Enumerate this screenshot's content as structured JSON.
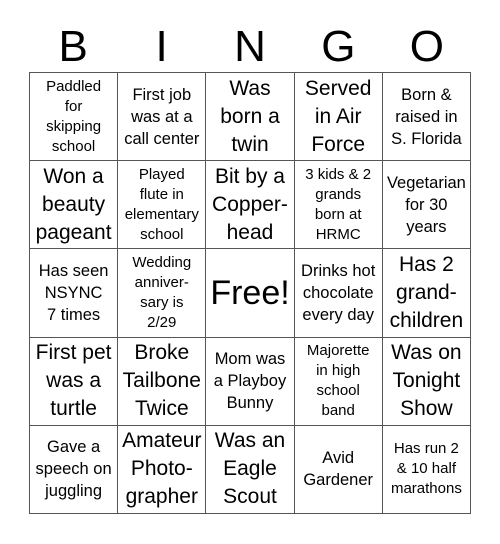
{
  "header": {
    "letters": [
      "B",
      "I",
      "N",
      "G",
      "O"
    ]
  },
  "cells": [
    [
      "Paddled\nfor\nskipping\nschool",
      "First job\nwas at a\ncall center",
      "Was\nborn a\ntwin",
      "Served\nin Air\nForce",
      "Born &\nraised in\nS. Florida"
    ],
    [
      "Won a\nbeauty\npageant",
      "Played\nflute in\nelementary\nschool",
      "Bit by a\nCopper-\nhead",
      "3 kids & 2\ngrands\nborn at\nHRMC",
      "Vegetarian\nfor 30\nyears"
    ],
    [
      "Has seen\nNSYNC\n7 times",
      "Wedding\nanniver-\nsary is\n2/29",
      "Free!",
      "Drinks hot\nchocolate\nevery day",
      "Has 2\ngrand-\nchildren"
    ],
    [
      "First pet\nwas a\nturtle",
      "Broke\nTailbone\nTwice",
      "Mom was\na Playboy\nBunny",
      "Majorette\nin high\nschool\nband",
      "Was on\nTonight\nShow"
    ],
    [
      "Gave a\nspeech on\njuggling",
      "Amateur\nPhoto-\ngrapher",
      "Was an\nEagle\nScout",
      "Avid\nGardener",
      "Has run 2\n& 10 half\nmarathons"
    ]
  ]
}
